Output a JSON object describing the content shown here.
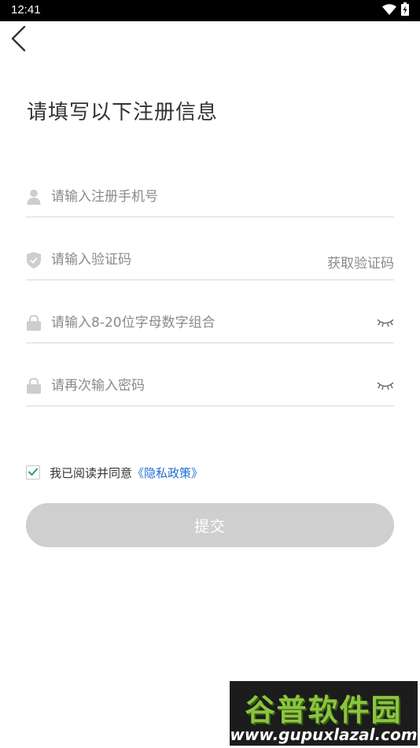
{
  "status_bar": {
    "time": "12:41",
    "icons": [
      "wifi-icon",
      "battery-charging-icon"
    ]
  },
  "header": {
    "back_icon": "chevron-left-icon",
    "title": "请填写以下注册信息"
  },
  "form": {
    "phone": {
      "placeholder": "请输入注册手机号",
      "icon": "user-icon"
    },
    "code": {
      "placeholder": "请输入验证码",
      "icon": "shield-icon",
      "button_label": "获取验证码"
    },
    "password": {
      "placeholder": "请输入8-20位字母数字组合",
      "icon": "lock-icon",
      "toggle_icon": "eye-closed-icon"
    },
    "confirm_password": {
      "placeholder": "请再次输入密码",
      "icon": "lock-icon",
      "toggle_icon": "eye-closed-icon"
    }
  },
  "agreement": {
    "checked": true,
    "text": "我已阅读并同意",
    "link_label": "《隐私政策》"
  },
  "submit": {
    "label": "提交",
    "enabled": false
  },
  "watermark": {
    "title": "谷普软件园",
    "url": "www.gupuxlazal.com"
  },
  "colors": {
    "link": "#1f6fd1",
    "check": "#2a9d8f",
    "submit_disabled_bg": "#cfcfcf",
    "divider": "#d9d9d9",
    "placeholder": "#8a8a8a",
    "watermark_green": "#8bc540"
  }
}
